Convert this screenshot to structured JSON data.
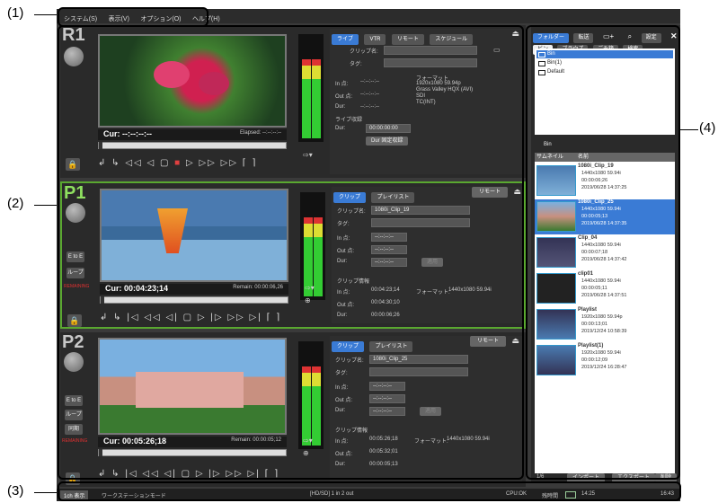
{
  "callouts": {
    "c1": "(1)",
    "c2": "(2)",
    "c3": "(3)",
    "c4": "(4)"
  },
  "menubar": {
    "items": [
      "システム(S)",
      "表示(V)",
      "オプション(O)",
      "ヘルプ(H)"
    ]
  },
  "r1": {
    "title": "R1",
    "tabs": [
      "ライブ",
      "VTR",
      "リモート",
      "スケジュール"
    ],
    "clipname_label": "クリップ名:",
    "tag_label": "タグ:",
    "in_label": "In 点:",
    "out_label": "Out 点:",
    "dur_label": "Dur:",
    "in_value": "--:--:--:--",
    "out_value": "--:--:--:--",
    "dur_value": "--:--:--:--",
    "format_label": "フォーマット",
    "format_lines": [
      "1920x1080 59.94p",
      "Grass Valley HQX (AVI)",
      "SDI",
      "TC(INT)"
    ],
    "live_rec_label": "ライブ収録",
    "live_dur_label": "Dur:",
    "live_dur_value": "00:00:00:00",
    "fixed_rec_button": "Dur 固定収録",
    "timecode": "Cur: --:--:--:--",
    "elapsed": "Elapsed: --:--:--:--"
  },
  "p1": {
    "title": "P1",
    "tabs": [
      "クリップ",
      "プレイリスト"
    ],
    "remote": "リモート",
    "clipname_label": "クリップ名:",
    "clipname_value": "1080i_Clip_19",
    "tag_label": "タグ:",
    "in_label": "In 点:",
    "out_label": "Out 点:",
    "dur_label": "Dur:",
    "in_value": "--:--:--:--",
    "out_value": "--:--:--:--",
    "dur_value": "--:--:--:--",
    "apply_button": "適用",
    "clipinfo_label": "クリップ情報",
    "ci_in": "00:04:23;14",
    "ci_out": "00:04:30;10",
    "ci_dur": "00:00:06;26",
    "ci_format_label": "フォーマット:",
    "ci_format": "1440x1080 59.94i",
    "timecode": "Cur: 00:04:23;14",
    "remain": "Remain: 00:00:06,26",
    "side": [
      "E to E",
      "ループ"
    ],
    "red": "REMAINING"
  },
  "p2": {
    "title": "P2",
    "tabs": [
      "クリップ",
      "プレイリスト"
    ],
    "remote": "リモート",
    "clipname_label": "クリップ名:",
    "clipname_value": "1080i_Clip_25",
    "tag_label": "タグ:",
    "in_label": "In 点:",
    "out_label": "Out 点:",
    "dur_label": "Dur:",
    "in_value": "--:--:--:--",
    "out_value": "--:--:--:--",
    "dur_value": "--:--:--:--",
    "apply_button": "適用",
    "clipinfo_label": "クリップ情報",
    "ci_in": "00:05:26;18",
    "ci_out": "00:05:32;01",
    "ci_dur": "00:00:05;13",
    "ci_format_label": "フォーマット:",
    "ci_format": "1440x1080 59.94i",
    "timecode": "Cur: 00:05:26;18",
    "remain": "Remain: 00:00:05;12",
    "side": [
      "E to E",
      "ループ",
      "同期"
    ],
    "red": "REMAINING"
  },
  "right": {
    "tabs": [
      "フォルダー",
      "転送"
    ],
    "settings": "設定",
    "subtabs": [
      "ビン",
      "ブラウズ",
      "ごみ箱",
      "検索"
    ],
    "tree": [
      "Bin",
      "Bin(1)",
      "Default"
    ],
    "bin_label": "Bin",
    "col_thumb": "サムネイル",
    "col_name": "名前",
    "clips": [
      {
        "name": "1080i_Clip_19",
        "l1": "1440x1080 59.94i",
        "l2": "00:00:06;26",
        "l3": "2019/06/28 14:37:25"
      },
      {
        "name": "1080i_Clip_25",
        "l1": "1440x1080 59.94i",
        "l2": "00:00:05;13",
        "l3": "2019/06/28 14:37:35"
      },
      {
        "name": "Clip_04",
        "l1": "1440x1080 59.94i",
        "l2": "00:00:07;18",
        "l3": "2019/06/28 14:37:42"
      },
      {
        "name": "clip01",
        "l1": "1440x1080 59.94i",
        "l2": "00:00:05;11",
        "l3": "2019/06/28 14:37:51"
      },
      {
        "name": "Playlist",
        "l1": "1920x1080 59.94p",
        "l2": "00:00:13;01",
        "l3": "2019/12/24 10:58:39"
      },
      {
        "name": "Playlist(1)",
        "l1": "1920x1080 59.94i",
        "l2": "00:00:12;09",
        "l3": "2019/12/24 16:28:47"
      }
    ],
    "count": "1/6",
    "import": "インポート",
    "export": "エクスポート",
    "delete": "削除"
  },
  "status": {
    "fullscreen": "1ch 表示",
    "mode": "ワークステーションモード",
    "io": "[HD/SD] 1 in 2 out",
    "cpu": "CPU:OK",
    "rec_time_label": "残時間",
    "rec_time": "14:25",
    "clock": "16:43"
  },
  "colors": {
    "accent": "#3a7bd5",
    "p1_border": "#5aa830",
    "bg": "#3a3a3a"
  }
}
